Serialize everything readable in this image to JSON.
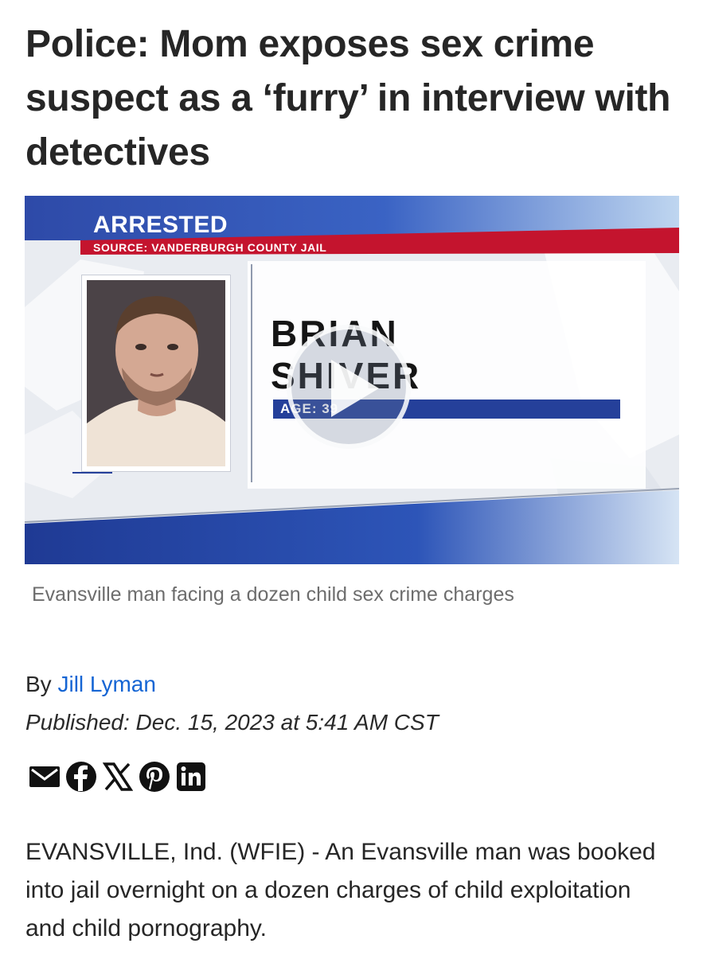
{
  "article": {
    "headline": "Police: Mom exposes sex crime suspect as a ‘furry’ in interview with detectives",
    "media": {
      "tag": "ARRESTED",
      "source": "SOURCE: VANDERBURGH COUNTY JAIL",
      "name_first": "BRIAN",
      "name_last": "SHIVER",
      "age": "AGE: 39",
      "play_icon": "play-icon"
    },
    "caption": "Evansville man facing a dozen child sex crime charges",
    "byline_prefix": "By",
    "author": "Jill Lyman",
    "published": "Published: Dec. 15, 2023 at 5:41 AM CST",
    "share_icons": [
      "email-icon",
      "facebook-icon",
      "x-icon",
      "pinterest-icon",
      "linkedin-icon"
    ],
    "body": "EVANSVILLE, Ind. (WFIE) - An Evansville man was booked into jail overnight on a dozen charges of child exploitation and child pornography."
  },
  "colors": {
    "author_link": "#1565d4",
    "brand_blue": "#25409a",
    "brand_red": "#c4142e",
    "caption_gray": "#6d6d6d"
  }
}
